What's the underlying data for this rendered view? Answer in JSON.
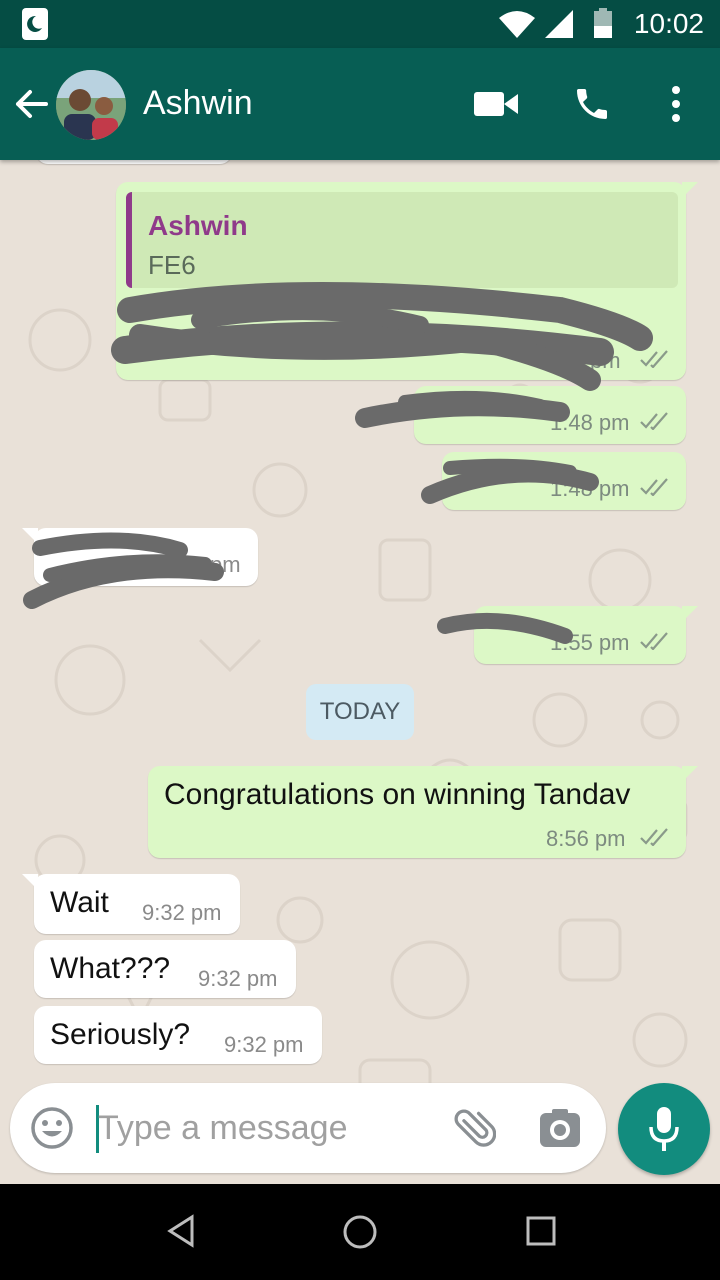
{
  "status_bar": {
    "time": "10:02"
  },
  "header": {
    "contact_name": "Ashwin"
  },
  "messages": [
    {
      "type": "outgoing",
      "quoted_name": "Ashwin",
      "quoted_text": "FE6",
      "text": "",
      "time": "pm",
      "redacted": true
    },
    {
      "type": "outgoing",
      "text": "",
      "time": "1:48 pm",
      "redacted": true
    },
    {
      "type": "outgoing",
      "text": "",
      "time": "1:48 pm",
      "redacted": true
    },
    {
      "type": "incoming",
      "text": "",
      "time": "pm",
      "redacted": true
    },
    {
      "type": "outgoing",
      "text": "",
      "time": "1:55 pm",
      "redacted": true
    },
    {
      "type": "outgoing",
      "text": "Congratulations on winning Tandav",
      "time": "8:56 pm"
    },
    {
      "type": "incoming",
      "text": "Wait",
      "time": "9:32 pm"
    },
    {
      "type": "incoming",
      "text": "What???",
      "time": "9:32 pm"
    },
    {
      "type": "incoming",
      "text": "Seriously?",
      "time": "9:32 pm"
    }
  ],
  "date_divider": "TODAY",
  "input": {
    "placeholder": "Type a message"
  },
  "colors": {
    "header": "#075e54",
    "outgoing_bubble": "#dcf8c6",
    "accent": "#128c7e"
  }
}
